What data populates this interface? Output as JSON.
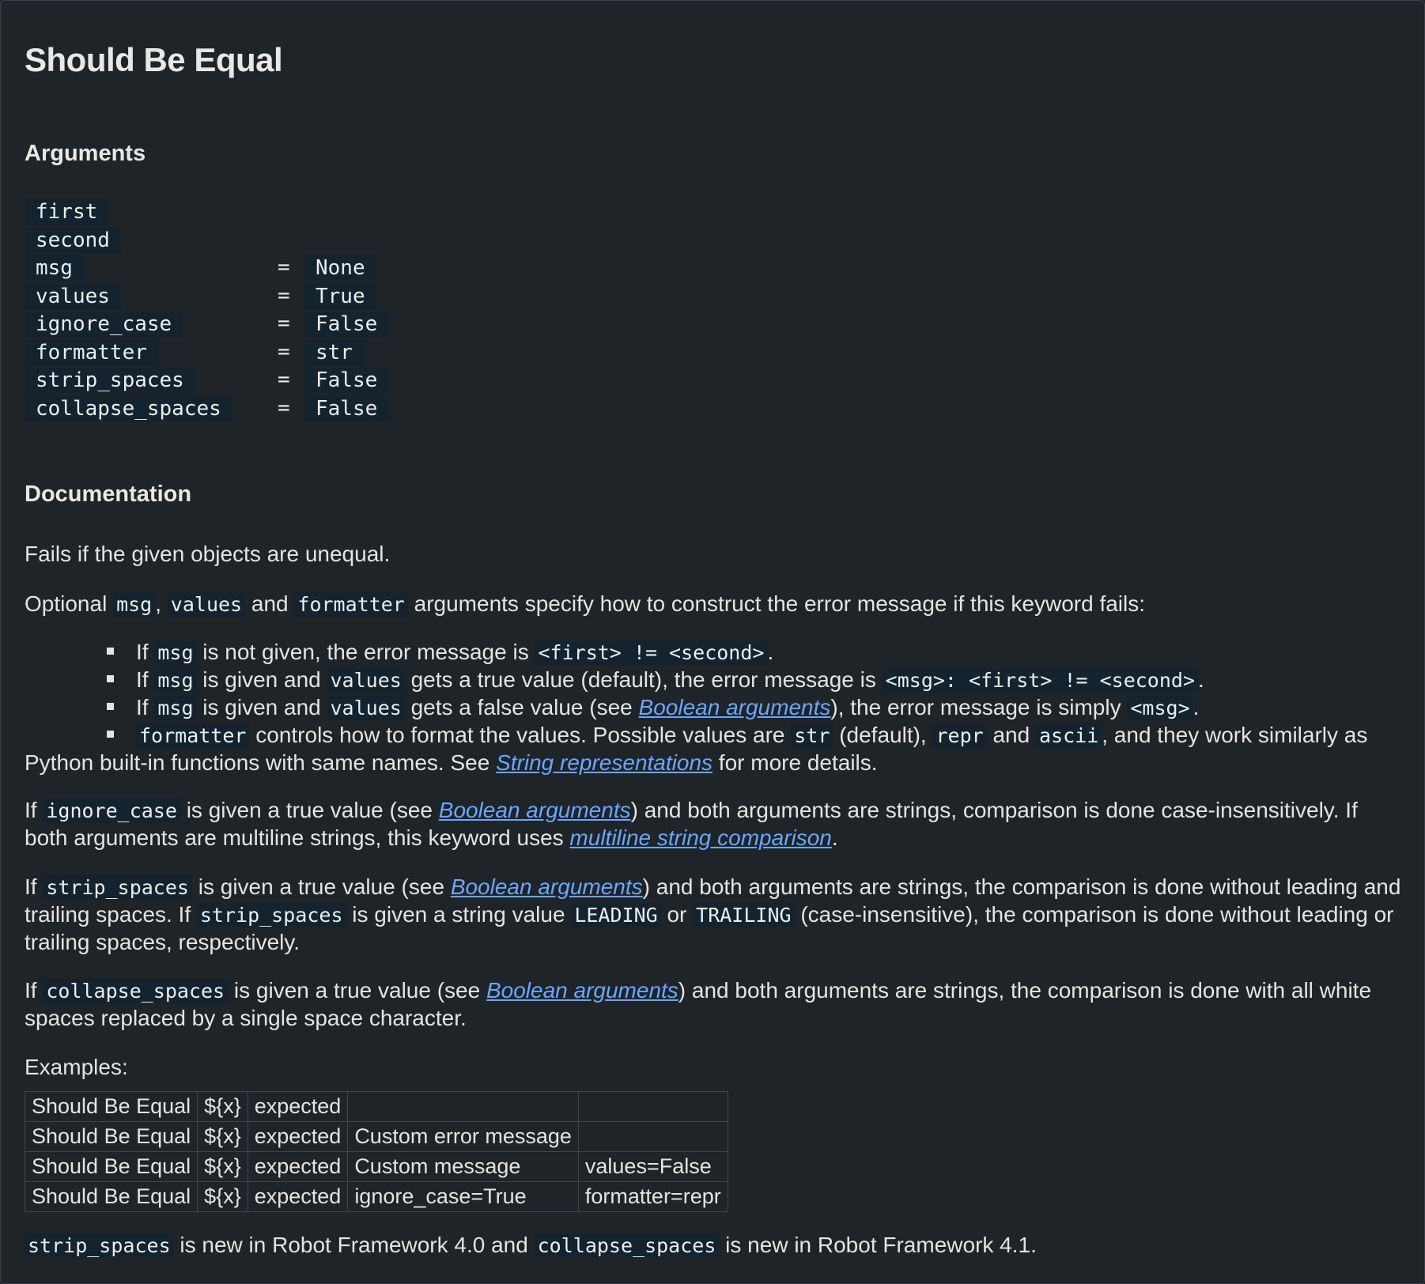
{
  "title": "Should Be Equal",
  "arguments_heading": "Arguments",
  "arguments": [
    {
      "name": "first",
      "eq": "",
      "default": ""
    },
    {
      "name": "second",
      "eq": "",
      "default": ""
    },
    {
      "name": "msg",
      "eq": "=",
      "default": "None"
    },
    {
      "name": "values",
      "eq": "=",
      "default": "True"
    },
    {
      "name": "ignore_case",
      "eq": "=",
      "default": "False"
    },
    {
      "name": "formatter",
      "eq": "=",
      "default": "str"
    },
    {
      "name": "strip_spaces",
      "eq": "=",
      "default": "False"
    },
    {
      "name": "collapse_spaces",
      "eq": "=",
      "default": "False"
    }
  ],
  "documentation_heading": "Documentation",
  "doc": {
    "p1": "Fails if the given objects are unequal.",
    "p2": {
      "t1": "Optional ",
      "c1": "msg",
      "t2": ", ",
      "c2": "values",
      "t3": " and ",
      "c3": "formatter",
      "t4": " arguments specify how to construct the error message if this keyword fails:"
    },
    "bullets": {
      "b1": {
        "t1": "If ",
        "c1": "msg",
        "t2": " is not given, the error message is ",
        "c2": "<first> != <second>",
        "t3": "."
      },
      "b2": {
        "t1": "If ",
        "c1": "msg",
        "t2": " is given and ",
        "c2": "values",
        "t3": " gets a true value (default), the error message is ",
        "c3": "<msg>: <first> != <second>",
        "t4": "."
      },
      "b3": {
        "t1": "If ",
        "c1": "msg",
        "t2": " is given and ",
        "c2": "values",
        "t3": " gets a false value (see ",
        "l1": "Boolean arguments",
        "t4": "), the error message is simply ",
        "c3": "<msg>",
        "t5": "."
      },
      "b4": {
        "c1": "formatter",
        "t1": " controls how to format the values. Possible values are ",
        "c2": "str",
        "t2": " (default), ",
        "c3": "repr",
        "t3": " and ",
        "c4": "ascii",
        "t4": ", and they work similarly as Python built-in functions with same names. See ",
        "l1": "String representations",
        "t5": " for more details."
      }
    },
    "p3": {
      "t1": "If ",
      "c1": "ignore_case",
      "t2": " is given a true value (see ",
      "l1": "Boolean arguments",
      "t3": ") and both arguments are strings, comparison is done case-insensitively. If both arguments are multiline strings, this keyword uses ",
      "l2": "multiline string comparison",
      "t4": "."
    },
    "p4": {
      "t1": "If ",
      "c1": "strip_spaces",
      "t2": " is given a true value (see ",
      "l1": "Boolean arguments",
      "t3": ") and both arguments are strings, the comparison is done without leading and trailing spaces. If ",
      "c2": "strip_spaces",
      "t4": " is given a string value ",
      "c3": "LEADING",
      "t5": " or ",
      "c4": "TRAILING",
      "t6": " (case-insensitive), the comparison is done without leading or trailing spaces, respectively."
    },
    "p5": {
      "t1": "If ",
      "c1": "collapse_spaces",
      "t2": " is given a true value (see ",
      "l1": "Boolean arguments",
      "t3": ") and both arguments are strings, the comparison is done with all white spaces replaced by a single space character."
    },
    "examples_label": "Examples:",
    "examples": [
      [
        "Should Be Equal",
        "${x}",
        "expected",
        "",
        ""
      ],
      [
        "Should Be Equal",
        "${x}",
        "expected",
        "Custom error message",
        ""
      ],
      [
        "Should Be Equal",
        "${x}",
        "expected",
        "Custom message",
        "values=False"
      ],
      [
        "Should Be Equal",
        "${x}",
        "expected",
        "ignore_case=True",
        "formatter=repr"
      ]
    ],
    "footer": {
      "c1": "strip_spaces",
      "t1": " is new in Robot Framework 4.0 and ",
      "c2": "collapse_spaces",
      "t2": " is new in Robot Framework 4.1."
    }
  }
}
